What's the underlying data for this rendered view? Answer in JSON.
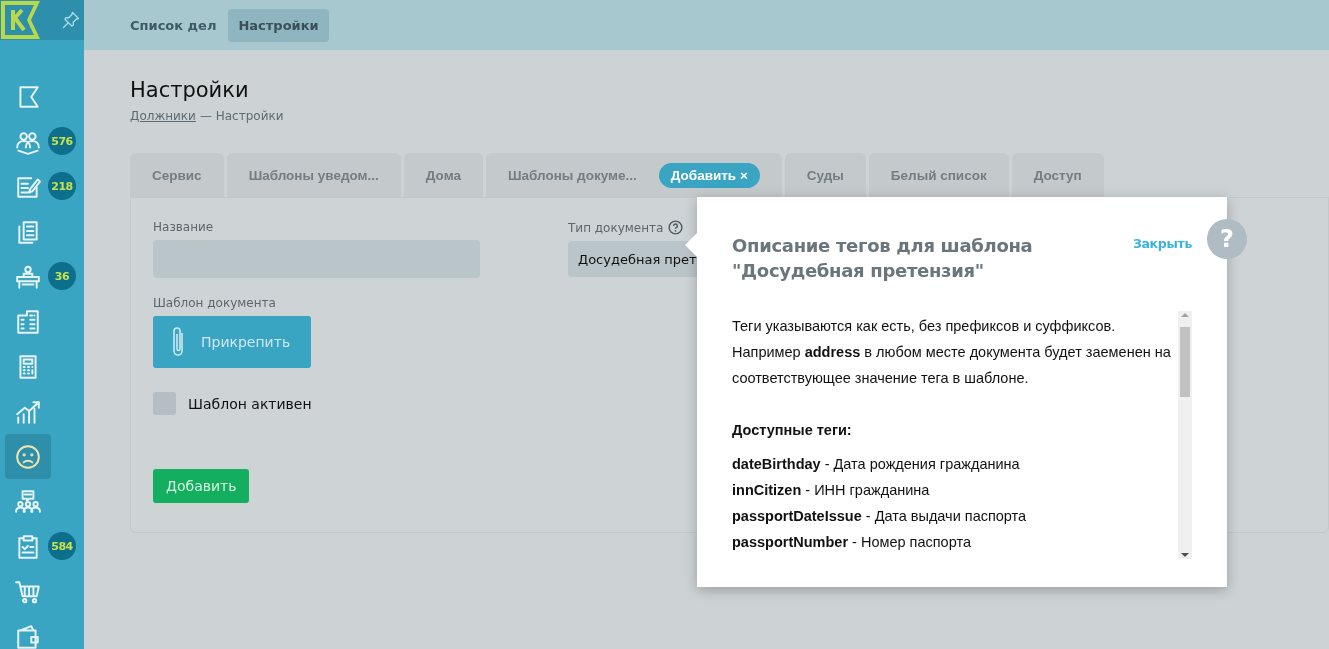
{
  "topbar": {
    "tabs": [
      {
        "label": "Список дел",
        "selected": false
      },
      {
        "label": "Настройки",
        "selected": true
      }
    ]
  },
  "sidebar": {
    "items": [
      {
        "selected": false
      },
      {
        "badge": "576",
        "selected": false
      },
      {
        "badge": "218",
        "selected": false
      },
      {
        "selected": false
      },
      {
        "badge": "36",
        "selected": false
      },
      {
        "selected": false
      },
      {
        "selected": false
      },
      {
        "selected": false
      },
      {
        "selected": true
      },
      {
        "selected": false
      },
      {
        "badge": "584",
        "selected": false
      },
      {
        "selected": false
      },
      {
        "selected": false
      }
    ]
  },
  "page": {
    "title": "Настройки",
    "breadcrumbs": [
      {
        "label": "Должники",
        "kind": "link"
      },
      {
        "label": "— Настройки",
        "kind": "text"
      }
    ]
  },
  "tabs": [
    {
      "label": "Сервис",
      "selected": false
    },
    {
      "label": "Шаблоны уведом...",
      "selected": false
    },
    {
      "label": "Дома",
      "selected": false
    },
    {
      "label": "Шаблоны докуме...",
      "selected": false,
      "hint": "Добавить ×"
    },
    {
      "label": "Суды",
      "selected": false
    },
    {
      "label": "Белый список",
      "selected": false
    },
    {
      "label": "Доступ",
      "selected": false
    }
  ],
  "form": {
    "name_label": "Название",
    "type_label": "Тип документа",
    "type_value": "Досудебная прет",
    "template_label": "Шаблон документа",
    "attach_button": "Прикрепить",
    "active_label": "Шаблон активен",
    "active_checked": false,
    "submit_button": "Добавить"
  },
  "popup": {
    "title": "Описание тегов для шаблона \"Досудебная претензия\"",
    "close": "Закрыть",
    "intro": [
      "Теги указываются как есть, без префиксов и суффиксов.",
      "Например **address** в любом месте документа будет заеменен на соответствующее значение тега в шаблоне."
    ],
    "tags_heading": "Доступные теги:",
    "tags": [
      "**dateBirthday** - Дата рождения гражданина",
      "**innCitizen** - ИНН гражданина",
      "**passportDateIssue** - Дата выдачи паспорта",
      "**passportNumber** - Номер паспорта"
    ],
    "help": "?"
  }
}
